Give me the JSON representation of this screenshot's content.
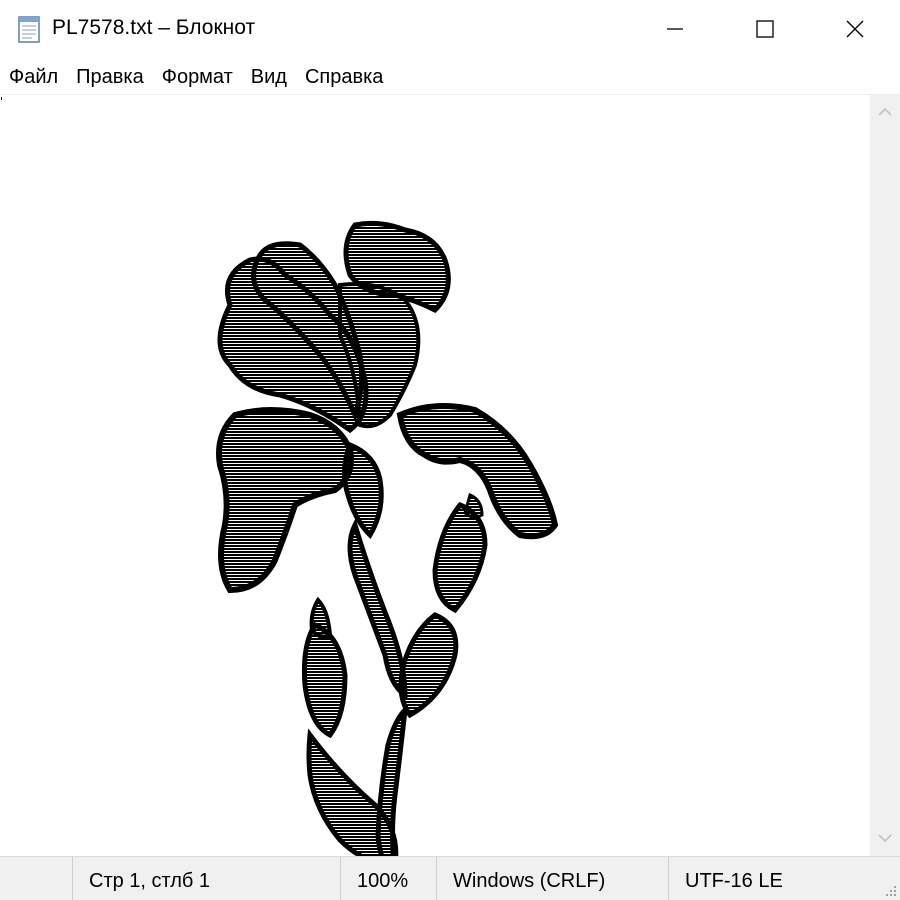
{
  "window": {
    "title": "PL7578.txt – Блокнот",
    "app_icon": "notepad-icon",
    "controls": {
      "minimize": "minimize-icon",
      "maximize": "maximize-icon",
      "close": "close-icon"
    }
  },
  "menu": {
    "items": [
      {
        "label": "Файл"
      },
      {
        "label": "Правка"
      },
      {
        "label": "Формат"
      },
      {
        "label": "Вид"
      },
      {
        "label": "Справка"
      }
    ]
  },
  "editor": {
    "content": "ASCII-art iris flower"
  },
  "statusbar": {
    "position": "Стр 1, стлб 1",
    "zoom": "100%",
    "line_endings": "Windows (CRLF)",
    "encoding": "UTF-16 LE"
  },
  "colors": {
    "petal_light": "#dcb8dc",
    "petal_dark": "#b48cb4",
    "stem": "#a8d0a0",
    "outline": "#000000",
    "chrome": "#f0f0f0"
  }
}
